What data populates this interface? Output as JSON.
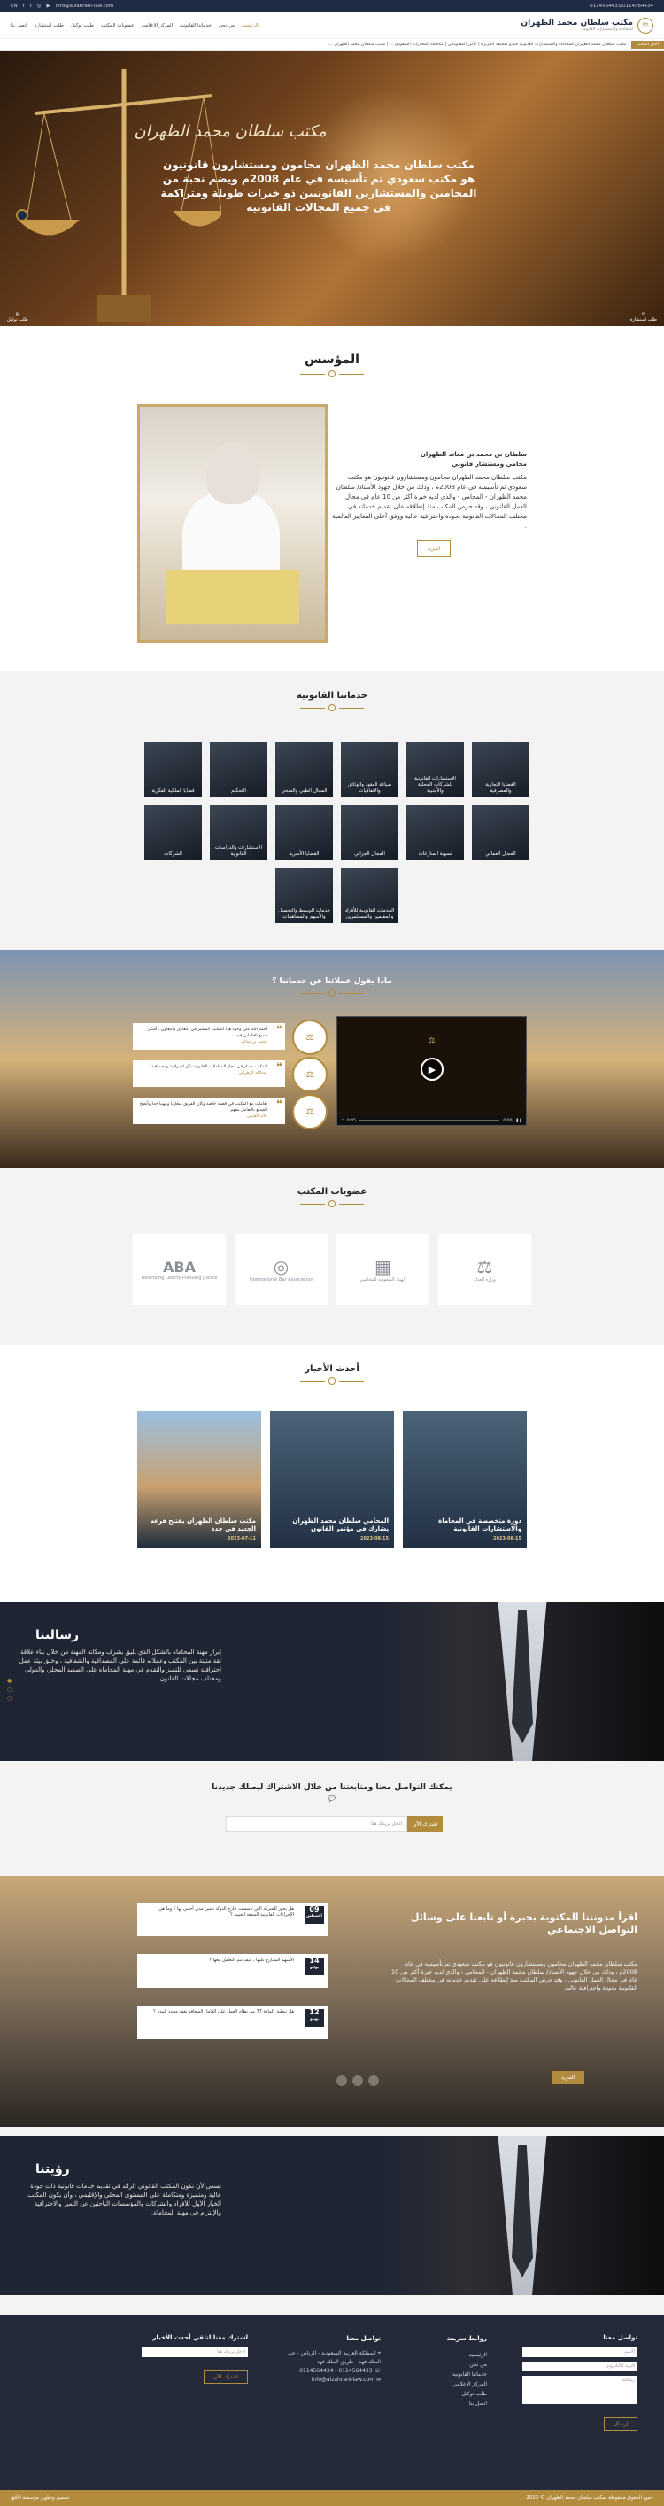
{
  "topbar": {
    "phone": "0114564433/0114564434",
    "email": "info@alzahrani-law.com",
    "social": [
      "facebook-icon",
      "twitter-icon",
      "instagram-icon",
      "youtube-icon",
      "linkedin-icon"
    ],
    "lang": "EN"
  },
  "header": {
    "logo_name": "مكتب سلطان محمد الظهران",
    "logo_sub": "للمحاماة والاستشارات القانونية",
    "nav": [
      "الرئيسية",
      "من نحن",
      "خدماتنا القانونية",
      "المركز الإعلامي",
      "عضويات المكتب",
      "طلب توكيل",
      "طلب استشارة",
      "اتصل بنا"
    ]
  },
  "ticker": {
    "tag": "أخبار المكتب",
    "text": "مكتب سلطان محمد الظهران للمحاماة والاستشارات القانونية فيديو صحيفه الجزيرة | الأمن المعلوماتي | مكافحة المخدرات السعودي ... | مكتب سلطان محمد الظهران ..."
  },
  "hero": {
    "signature": "مكتب سلطان محمد الظهران",
    "text": "مكتب سلطان محمد الظهران محامون ومستشارون قانونيون هو مكتب سعودي تم تأسيسه في عام 2008م ويضم نخبة من المحامين والمستشارين القانونيين ذو خبرات طويلة ومتراكمة في جميع المجالات القانونية",
    "corner_right": "طلب استشارة",
    "corner_left": "طلب توكيل"
  },
  "founder": {
    "title": "المؤسس",
    "name": "سلطان بن محمد بن معاند الظهران",
    "role": "محامي ومستشار قانوني",
    "bio": "مكتب سلطان محمد الظهران محامون ومستشارون قانونيون هو مكتب سعودي تم تأسيسه في عام 2008م ، وذلك من خلال جهود الأستاذ/ سلطان محمد الظهران - المحامي - والذي لديه خبرة أكثر من 10 عام في مجال العمل القانوني ، وقد حرص المكتب منذ إنطلاقه على تقديم خدماته في مختلف المجالات القانونية بجودة واحترافية عالية ووفق أعلى المعايير العالمية .",
    "more": "المزيد"
  },
  "services": {
    "title": "خدماتنا القانونية",
    "items": [
      "القضايا التجارية والمصرفية",
      "الاستشارات القانونية للشركات المحلية والأجنبية",
      "صياغة العقود والوثائق والاتفاقيات",
      "المجال الطبي والصحي",
      "التحكيم",
      "قضايا الملكية الفكرية",
      "المجال العمالي",
      "تسوية المنازعات",
      "المجال الجزائي",
      "القضايا الأسرية",
      "الاستشارات والدراسات القانونية",
      "الشركات",
      "الخدمات القانونية للأفراد والمقيمين والمستثمرين",
      "خدمات الوسيط والتحصيل والأسهم والمساهمات"
    ]
  },
  "testimonials": {
    "title": "ماذا يقول عملائنا عن خدماتنا ؟",
    "items": [
      {
        "text": "أحمد الله على وجود هذا المكتب المتميز في التعامل والتعاون ، أشكر جميع العاملين فيه",
        "author": "محمد بن سالم"
      },
      {
        "text": "المكتب ممتاز في إنجاز المعاملات القانونية بكل احترافية ومصداقية",
        "author": "عبدالله الزهراني"
      },
      {
        "text": "تعاملت مع المكتب في قضية خاصة وكان الفريق متعاونا ومهنيا جدا وأنصح الجميع بالتعامل معهم",
        "author": "خالد العتيبي"
      }
    ],
    "video": {
      "time": "0:00",
      "duration": "0:45"
    }
  },
  "members": {
    "title": "عضويات المكتب",
    "items": [
      "Defending Liberty Pursuing Justice",
      "International Bar Association",
      "الهيئة السعودية للمحامين",
      "وزارة العدل"
    ]
  },
  "news": {
    "title": "أحدث الأخبار",
    "items": [
      {
        "title": "دورة متخصصة في المحاماة والاستشارات القانونية",
        "date": "2023-08-15"
      },
      {
        "title": "المحامي سلطان محمد الظهران يشارك في مؤتمر القانون",
        "date": "2023-08-15"
      },
      {
        "title": "مكتب سلطان الظهران يفتتح فرعه الجديد في جدة",
        "date": "2023-07-11"
      }
    ]
  },
  "mission": {
    "title": "رسالتنا",
    "text": "إبراز مهنة المحاماة بالشكل الذي يليق بشرف ومكانة المهنة من خلال بناء علاقة ثقة متينة بين المكتب وعملائه قائمة على المصداقية والشفافية ، وخلق بيئة عمل احترافية تسعى للتميز والتقدم في مهنة المحاماة على الصعيد المحلي والدولي ومختلف مجالات القانون."
  },
  "newsletter": {
    "title": "يمكنك التواصل معنا ومتابعتنا من خلال الاشتراك ليصلك جديدنا",
    "placeholder": "ادخل بريدك هنا",
    "button": "اشترك الآن"
  },
  "blog": {
    "title": "اقرأ مدونتنا المكتوبة بخبرة أو تابعنا على وسائل التواصل الاجتماعي",
    "text": "مكتب سلطان محمد الظهران محامون ومستشارون قانونيون هو مكتب سعودي تم تأسيسه في عام 2008م ، وذلك من خلال جهود الأستاذ/ سلطان محمد الظهران - المحامي - والذي لديه خبرة أكثر من 10 عام في مجال العمل القانوني ، وقد حرص المكتب منذ إنطلاقه على تقديم خدماته في مختلف المجالات القانونية بجودة واحترافية عالية.",
    "more": "المزيد",
    "posts": [
      {
        "day": "09",
        "month": "أغسطس",
        "title": "هل يجوز للشركة التي تأسست خارج الدولة تعيين مدير أجنبي لها ؟ وما هي الإجراءات القانونية المتبعة لتعيينه ؟"
      },
      {
        "day": "14",
        "month": "يوليو",
        "title": "الأسهم المتنازع عليها ، كيف يتم التعامل معها ؟"
      },
      {
        "day": "12",
        "month": "يونيو",
        "title": "هل تنطبق المادة 77 من نظام العمل على العامل المتعاقد بعقد محدد المدة ؟"
      }
    ]
  },
  "vision": {
    "title": "رؤيتنا",
    "text": "نسعى لأن نكون المكتب القانوني الرائد في تقديم خدمات قانونية ذات جودة عالية ومتميزة ومتكاملة على المستوى المحلي والإقليمي ، وأن يكون المكتب الخيار الأول للأفراد والشركات والمؤسسات الباحثين عن التميز والاحترافية والإلتزام في مهنة المحاماة."
  },
  "footer": {
    "contact_form": {
      "title": "تواصل معنا",
      "name": "الاسم",
      "email": "البريد الالكتروني",
      "message": "رسالتك",
      "send": "إرسال"
    },
    "links": {
      "title": "روابط سريعة",
      "items": [
        "الرئيسية",
        "من نحن",
        "خدماتنا القانونية",
        "المركز الإعلامي",
        "طلب توكيل",
        "اتصل بنا"
      ]
    },
    "info": {
      "title": "تواصل معنا",
      "lines": [
        "المملكة العربية السعودية - الرياض - حي الملك فهد - طريق الملك فهد",
        "0114564433 - 0114564434",
        "info@alzahrani-law.com"
      ]
    },
    "subscribe": {
      "title": "اشترك معنا لتلقي أحدث الأخبار",
      "placeholder": "ادخل بريدك هنا",
      "button": "اشترك الآن"
    }
  },
  "copyright": {
    "right": "جميع الحقوق محفوظة لمكتب سلطان محمد الظهران © 2023",
    "left": "تصميم وتطوير مؤسسة الأفق"
  }
}
